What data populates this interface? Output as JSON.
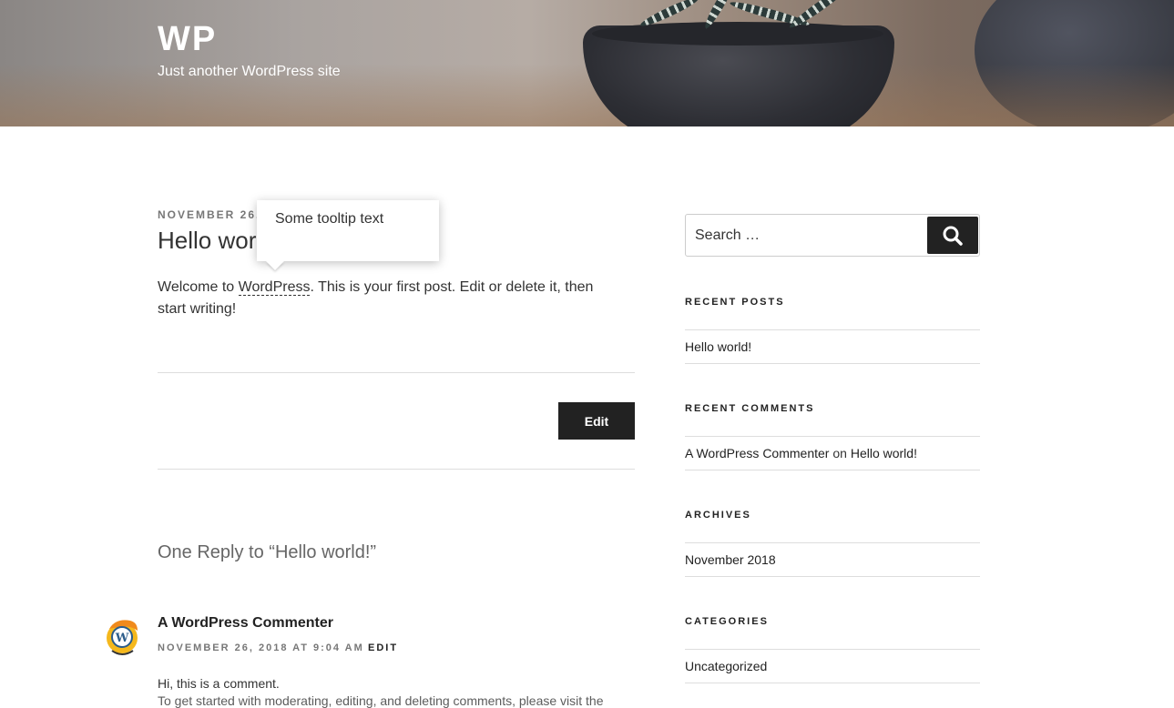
{
  "site": {
    "title": "WP",
    "description": "Just another WordPress site"
  },
  "post": {
    "date": "NOVEMBER 26,",
    "title": "Hello wor",
    "body_before": "Welcome to ",
    "body_link": "WordPress",
    "body_after": ". This is your first post. Edit or delete it, then",
    "body_line2": "start writing!",
    "edit_label": "Edit"
  },
  "tooltip": {
    "text": "Some tooltip text"
  },
  "comments": {
    "title": "One Reply to “Hello world!”",
    "items": [
      {
        "author": "A WordPress Commenter",
        "meta": "NOVEMBER 26, 2018 AT 9:04 AM",
        "edit_label": "EDIT",
        "text": "Hi, this is a comment.",
        "text_cut": "To get started with moderating, editing, and deleting comments, please visit the"
      }
    ]
  },
  "sidebar": {
    "search": {
      "placeholder": "Search …",
      "icon": "search-icon"
    },
    "recent_posts": {
      "title": "RECENT POSTS",
      "items": [
        "Hello world!"
      ]
    },
    "recent_comments": {
      "title": "RECENT COMMENTS",
      "author": "A WordPress Commenter",
      "connector": "on",
      "post": "Hello world!"
    },
    "archives": {
      "title": "ARCHIVES",
      "items": [
        "November 2018"
      ]
    },
    "categories": {
      "title": "CATEGORIES",
      "items": [
        "Uncategorized"
      ]
    }
  },
  "colors": {
    "button_bg": "#222222",
    "text": "#333333",
    "muted": "#777777",
    "divider": "#dddddd"
  }
}
